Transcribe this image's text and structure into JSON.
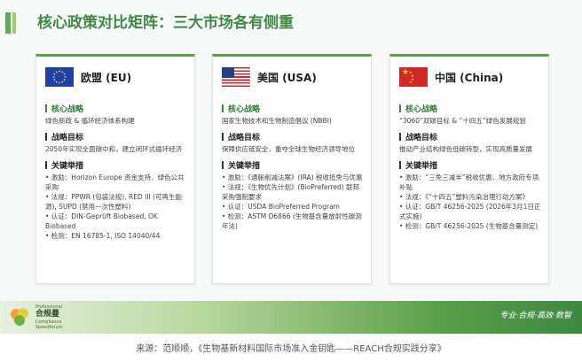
{
  "title": "核心政策对比矩阵：三大市场各有侧重",
  "cards": [
    {
      "flag": "eu-flag-icon",
      "name": "欧盟 (EU)",
      "strategy_title": "核心战略",
      "strategy_text": "绿色新政 & 循环经济体系构建",
      "goal_title": "战略目标",
      "goal_text": "2050年实现全面碳中和，建立闭环式循环经济",
      "measures_title": "关键举措",
      "measures": [
        "• 激励：Horizon Europe 资金支持、绿色公共采购",
        "• 法规：PPWR (包装法规), RED III (可再生能源), SUPD (禁用一次性塑料)",
        "• 认证：DIN-Geprüft Biobased, OK Biobased",
        "• 检测：EN 16785-1, ISO 14040/44"
      ]
    },
    {
      "flag": "us-flag-icon",
      "name": "美国 (USA)",
      "strategy_title": "核心战略",
      "strategy_text": "国家生物技术和生物制造倡议 (NBBI)",
      "goal_title": "战略目标",
      "goal_text": "保障供应链安全，重夺全球生物经济领导地位",
      "measures_title": "关键举措",
      "measures": [
        "• 激励：《通胀削减法案》(IRA) 税收抵免与优惠",
        "• 法规：《生物优先计划》(BioPreferred) 联邦采购强制要求",
        "• 认证：USDA BioPreferred Program",
        "• 检测：ASTM D6866 (生物基含量放射性碳测年法)"
      ]
    },
    {
      "flag": "cn-flag-icon",
      "name": "中国 (China)",
      "strategy_title": "核心战略",
      "strategy_text": "“3060”双碳目标 & “十四五”绿色发展规划",
      "goal_title": "战略目标",
      "goal_text": "推动产业结构绿色低碳转型，实现高质量发展",
      "measures_title": "关键举措",
      "measures": [
        "• 激励：“三免三减半”税收优惠、地方政府专项补贴",
        "• 法规：《“十四五”塑料污染治理行动方案》",
        "• 认证：GB/T 46256-2025 (2026年3月1日正式实施)",
        "• 检测：GB/T 46256-2025 (生物基含量测定)"
      ]
    }
  ],
  "footer": {
    "logo_cn": "合规曼",
    "logo_en_1": "Professional",
    "logo_en_2": "Compliance",
    "logo_en_3": "Speedforum",
    "slogan": "专业·合规·高效·数智"
  },
  "caption": "来源：范顺顺，《生物基新材料国际市场准入金钥匙——REACH合规实践分享》",
  "colors": {
    "accent": "#3f8a43",
    "light_green": "#9ccf6b",
    "card_border": "#5ea245"
  }
}
